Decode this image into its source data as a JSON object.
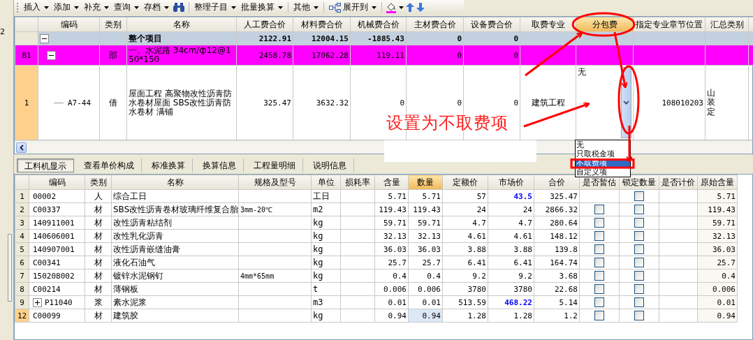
{
  "left_strip": {
    "text": "2"
  },
  "toolbar": {
    "items": [
      {
        "kind": "menu",
        "label": "插入"
      },
      {
        "kind": "menu",
        "label": "添加"
      },
      {
        "kind": "menu",
        "label": "补充"
      },
      {
        "kind": "menu",
        "label": "查询"
      },
      {
        "kind": "menu",
        "label": "存档"
      },
      {
        "kind": "binoculars"
      },
      {
        "kind": "separator"
      },
      {
        "kind": "menu",
        "label": "整理子目"
      },
      {
        "kind": "menu",
        "label": "批量换算"
      },
      {
        "kind": "separator"
      },
      {
        "kind": "menu",
        "label": "其他"
      },
      {
        "kind": "separator"
      },
      {
        "kind": "expand",
        "label": "展开到"
      },
      {
        "kind": "separator"
      },
      {
        "kind": "paint"
      },
      {
        "kind": "up"
      },
      {
        "kind": "down"
      }
    ]
  },
  "top_grid": {
    "columns": [
      {
        "label": "编码",
        "selected": false
      },
      {
        "label": "类别",
        "selected": false
      },
      {
        "label": "名称",
        "selected": false
      },
      {
        "label": "人工费合价",
        "selected": false
      },
      {
        "label": "材料费合价",
        "selected": false
      },
      {
        "label": "机械费合价",
        "selected": false
      },
      {
        "label": "主材费合价",
        "selected": false
      },
      {
        "label": "设备费合价",
        "selected": false
      },
      {
        "label": "取费专业",
        "selected": false
      },
      {
        "label": "分包费",
        "selected": true
      },
      {
        "label": "指定专业章节位置",
        "selected": false
      },
      {
        "label": "汇总类别",
        "selected": false
      }
    ],
    "rows": [
      {
        "kind": "total",
        "selected": false,
        "expanded": true,
        "name": "整个项目",
        "labor": "2122.91",
        "material": "12004.15",
        "machine": "-1885.43",
        "main_material": "0",
        "equipment": "0"
      },
      {
        "kind": "section",
        "selected": false,
        "expanded": true,
        "number": "B1",
        "type": "部",
        "name": "一、水泥路 34cm/ф12@150*150",
        "labor": "2458.78",
        "material": "17062.28",
        "machine": "119.11",
        "main_material": "0",
        "equipment": "0"
      },
      {
        "kind": "item",
        "selected": true,
        "number": "1",
        "code": "A7-44",
        "type": "借",
        "name": "屋面工程 高聚物改性沥青防水卷材屋面 SBS改性沥青防水卷材 满铺",
        "labor": "325.47",
        "material": "3632.32",
        "machine": "0",
        "main_material": "0",
        "equipment": "0",
        "fee_major": "建筑工程",
        "subcontract": "无",
        "chapter": "108010203",
        "summary": "山装定"
      }
    ]
  },
  "dropdown": {
    "options": [
      {
        "label": "无",
        "selected": false
      },
      {
        "label": "只取税金项",
        "selected": false
      },
      {
        "label": "不取费项",
        "selected": true
      },
      {
        "label": "自定义项",
        "selected": false
      }
    ]
  },
  "annotation": {
    "text": "设置为不取费项"
  },
  "tabs": [
    {
      "label": "工料机显示",
      "selected": true
    },
    {
      "label": "查看单价构成",
      "selected": false
    },
    {
      "label": "标准换算",
      "selected": false
    },
    {
      "label": "换算信息",
      "selected": false
    },
    {
      "label": "工程量明细",
      "selected": false
    },
    {
      "label": "说明信息",
      "selected": false
    }
  ],
  "bottom_grid": {
    "columns": [
      {
        "label": "编码",
        "selected": false
      },
      {
        "label": "类别",
        "selected": false
      },
      {
        "label": "名称",
        "selected": false
      },
      {
        "label": "规格及型号",
        "selected": false
      },
      {
        "label": "单位",
        "selected": false
      },
      {
        "label": "损耗率",
        "selected": false
      },
      {
        "label": "含量",
        "selected": false
      },
      {
        "label": "数量",
        "selected": true
      },
      {
        "label": "定额价",
        "selected": false
      },
      {
        "label": "市场价",
        "selected": false
      },
      {
        "label": "合价",
        "selected": false
      },
      {
        "label": "是否暂估",
        "selected": false
      },
      {
        "label": "锁定数量",
        "selected": false
      },
      {
        "label": "是否计价",
        "selected": false
      },
      {
        "label": "原始含量",
        "selected": false
      }
    ],
    "rows": [
      {
        "number": "1",
        "selected": false,
        "code": "00002",
        "type": "人",
        "name": "综合工日",
        "unit": "工日",
        "content": "5.71",
        "qty": "5.71",
        "quota": "57",
        "market": "43.5",
        "market_adjusted": true,
        "total": "325.47",
        "locked": false,
        "original": "5.71"
      },
      {
        "number": "2",
        "selected": false,
        "code": "C00337",
        "type": "材",
        "name": "SBS改性沥青卷材玻璃纤维复合胎",
        "spec": "3mm-20℃",
        "unit": "m2",
        "content": "119.43",
        "qty": "119.43",
        "quota": "24",
        "market": "24",
        "market_adjusted": false,
        "total": "2866.32",
        "provisional": false,
        "locked": false,
        "original": "119.43"
      },
      {
        "number": "3",
        "selected": false,
        "code": "140911001",
        "type": "材",
        "name": "改性沥青粘结剂",
        "unit": "kg",
        "content": "59.71",
        "qty": "59.71",
        "quota": "4.7",
        "market": "4.7",
        "market_adjusted": false,
        "total": "280.64",
        "provisional": false,
        "locked": false,
        "original": "59.71"
      },
      {
        "number": "4",
        "selected": false,
        "code": "140606001",
        "type": "材",
        "name": "改性乳化沥青",
        "unit": "kg",
        "content": "32.13",
        "qty": "32.13",
        "quota": "4.61",
        "market": "4.61",
        "market_adjusted": false,
        "total": "148.12",
        "provisional": false,
        "locked": false,
        "original": "32.13"
      },
      {
        "number": "5",
        "selected": false,
        "code": "140907001",
        "type": "材",
        "name": "改性沥青嵌缝油膏",
        "unit": "kg",
        "content": "36.03",
        "qty": "36.03",
        "quota": "3.88",
        "market": "3.88",
        "market_adjusted": false,
        "total": "139.8",
        "provisional": false,
        "locked": false,
        "original": "36.03"
      },
      {
        "number": "6",
        "selected": false,
        "code": "C00341",
        "type": "材",
        "name": "液化石油气",
        "unit": "kg",
        "content": "25.7",
        "qty": "25.7",
        "quota": "6.41",
        "market": "6.41",
        "market_adjusted": false,
        "total": "164.74",
        "provisional": false,
        "locked": false,
        "original": "25.7"
      },
      {
        "number": "7",
        "selected": false,
        "code": "150208002",
        "type": "材",
        "name": "镀锌水泥钢钉",
        "spec": "4mm*65mm",
        "unit": "kg",
        "content": "0.4",
        "qty": "0.4",
        "quota": "9.2",
        "market": "9.2",
        "market_adjusted": false,
        "total": "3.68",
        "provisional": false,
        "locked": false,
        "original": "0.4"
      },
      {
        "number": "8",
        "selected": false,
        "code": "C00214",
        "type": "材",
        "name": "薄钢板",
        "unit": "t",
        "content": "0.006",
        "qty": "0.006",
        "quota": "3780",
        "market": "3780",
        "market_adjusted": false,
        "total": "22.68",
        "provisional": false,
        "locked": false,
        "original": "0.006"
      },
      {
        "number": "9",
        "selected": false,
        "expanded": false,
        "code": "P11040",
        "type": "浆",
        "name": "素水泥浆",
        "unit": "m3",
        "content": "0.01",
        "qty": "0.01",
        "quota": "513.59",
        "market": "468.22",
        "market_adjusted": true,
        "total": "5.14",
        "provisional": false,
        "locked": false,
        "original": "0.01"
      },
      {
        "number": "12",
        "selected": true,
        "code": "C00099",
        "type": "材",
        "name": "建筑胶",
        "unit": "kg",
        "content": "0.94",
        "qty": "0.94",
        "quota": "1.28",
        "market": "1.28",
        "market_adjusted": false,
        "total": "1.2",
        "provisional": false,
        "locked": false,
        "original": "0.94"
      }
    ]
  }
}
